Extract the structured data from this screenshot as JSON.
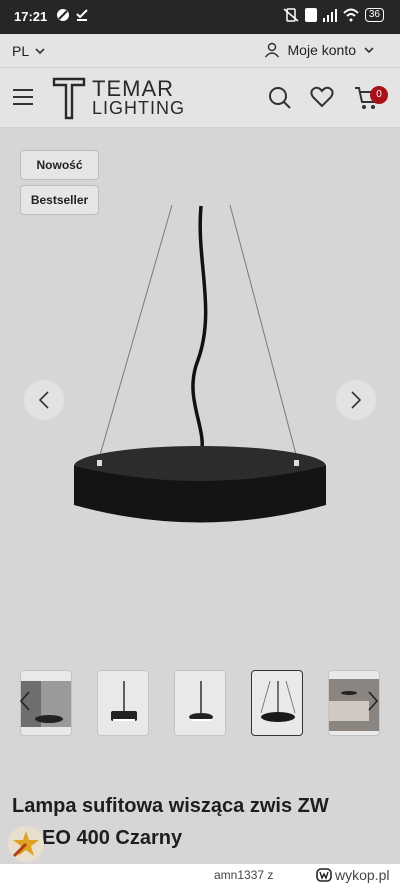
{
  "status_bar": {
    "time": "17:21",
    "battery": "36"
  },
  "topbar": {
    "language": "PL",
    "account_label": "Moje konto"
  },
  "header": {
    "logo_brand": "TEMAR",
    "logo_sub": "LIGHTING",
    "cart_count": "0"
  },
  "tags": [
    "Nowość",
    "Bestseller"
  ],
  "product": {
    "title_line1": "Lampa sufitowa wisząca zwis ZW",
    "title_line2": "EO 400 Czarny"
  },
  "bottom_bar": {
    "user": "amn1337  z",
    "site": "wykop.pl"
  },
  "colors": {
    "accent": "#a8101a",
    "background": "#d6d6d6"
  }
}
